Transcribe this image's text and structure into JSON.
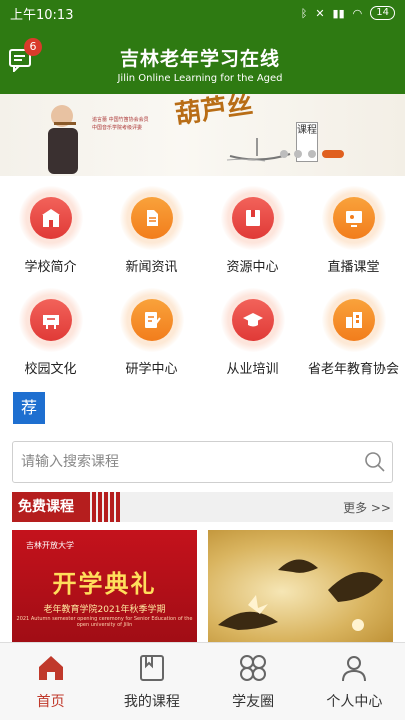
{
  "status_bar": {
    "time": "上午10:13",
    "battery": "14"
  },
  "header": {
    "title_cn": "吉林老年学习在线",
    "title_en": "Jilin Online Learning for the Aged",
    "message_badge": "6"
  },
  "banner": {
    "lines": [
      "追言蕾  中国竹笛协会会员",
      "中国音乐学院考级评委"
    ],
    "calligraphy": "葫芦丝",
    "tag": "课程",
    "slide_count": 4,
    "active_slide": 4
  },
  "menu": {
    "items": [
      {
        "label": "学校简介",
        "icon": "school-icon",
        "color": "red"
      },
      {
        "label": "新闻资讯",
        "icon": "news-icon",
        "color": "orange"
      },
      {
        "label": "资源中心",
        "icon": "book-icon",
        "color": "red"
      },
      {
        "label": "直播课堂",
        "icon": "live-class-icon",
        "color": "orange"
      },
      {
        "label": "校园文化",
        "icon": "culture-icon",
        "color": "red"
      },
      {
        "label": "研学中心",
        "icon": "study-icon",
        "color": "orange"
      },
      {
        "label": "从业培训",
        "icon": "graduation-cap-icon",
        "color": "red"
      },
      {
        "label": "省老年教育协会",
        "icon": "building-icon",
        "color": "orange"
      }
    ]
  },
  "recommend": {
    "label": "荐"
  },
  "search": {
    "placeholder": "请输入搜索课程"
  },
  "free_courses": {
    "title": "免费课程",
    "more": "更多 >>",
    "cards": [
      {
        "university": "吉林开放大学",
        "headline": "开学典礼",
        "subtitle": "老年教育学院2021年秋季学期",
        "english": "2021 Autumn semester opening ceremony for Senior Education of the open university of Jilin"
      }
    ]
  },
  "bottom_nav": {
    "items": [
      {
        "label": "首页",
        "icon": "home-icon",
        "active": true
      },
      {
        "label": "我的课程",
        "icon": "course-book-icon",
        "active": false
      },
      {
        "label": "学友圈",
        "icon": "circle-grid-icon",
        "active": false
      },
      {
        "label": "个人中心",
        "icon": "person-icon",
        "active": false
      }
    ]
  },
  "colors": {
    "brand_green": "#2e7a12",
    "accent_red": "#c0392b",
    "recommend_blue": "#1e6fd0"
  }
}
